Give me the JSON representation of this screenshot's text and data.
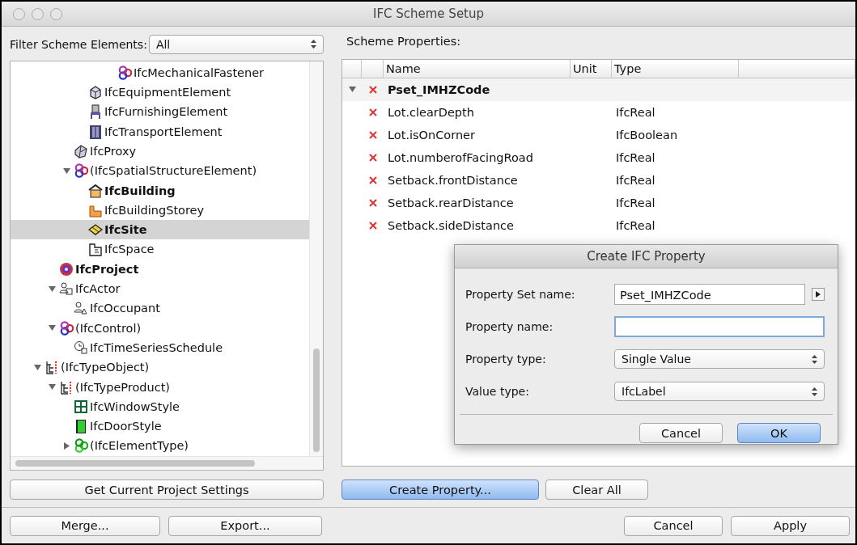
{
  "window": {
    "title": "IFC Scheme Setup"
  },
  "filter": {
    "label": "Filter Scheme Elements:",
    "value": "All"
  },
  "tree": [
    {
      "children": [
        {
          "children": [
            {
              "children": [
                {
                  "children": [
                    {
                      "children": [
                        {
                          "label": "IfcMechanicalFastener",
                          "kind": "tricolor",
                          "bold": false,
                          "selected": false
                        }
                      ]
                    }
                  ]
                },
                {
                  "label": "IfcEquipmentElement",
                  "kind": "equipment",
                  "bold": false,
                  "selected": false
                },
                {
                  "label": "IfcFurnishingElement",
                  "kind": "chair",
                  "bold": false,
                  "selected": false
                },
                {
                  "label": "IfcTransportElement",
                  "kind": "transport",
                  "bold": false,
                  "selected": false
                }
              ]
            },
            {
              "label": "IfcProxy",
              "kind": "proxy",
              "bold": false,
              "selected": false
            },
            {
              "label": "(IfcSpatialStructureElement)",
              "kind": "tricolor",
              "bold": false,
              "selected": false,
              "expanded": true,
              "children": [
                {
                  "label": "IfcBuilding",
                  "kind": "building",
                  "bold": true,
                  "selected": false
                },
                {
                  "label": "IfcBuildingStorey",
                  "kind": "storey",
                  "bold": false,
                  "selected": false
                },
                {
                  "label": "IfcSite",
                  "kind": "site",
                  "bold": true,
                  "selected": true
                },
                {
                  "label": "IfcSpace",
                  "kind": "space",
                  "bold": false,
                  "selected": false
                }
              ]
            }
          ]
        },
        {
          "label": "IfcProject",
          "kind": "project",
          "bold": true,
          "selected": false
        },
        {
          "label": "IfcActor",
          "kind": "actor",
          "bold": false,
          "selected": false,
          "expanded": true,
          "children": [
            {
              "label": "IfcOccupant",
              "kind": "occupant",
              "bold": false,
              "selected": false
            }
          ]
        },
        {
          "label": "(IfcControl)",
          "kind": "tricolor",
          "bold": false,
          "selected": false,
          "expanded": true,
          "children": [
            {
              "label": "IfcTimeSeriesSchedule",
              "kind": "schedule",
              "bold": false,
              "selected": false
            }
          ]
        }
      ]
    },
    {
      "label": "(IfcTypeObject)",
      "kind": "typetree",
      "bold": false,
      "selected": false,
      "expanded": true,
      "children": [
        {
          "label": "(IfcTypeProduct)",
          "kind": "typetree",
          "bold": false,
          "selected": false,
          "expanded": true,
          "children": [
            {
              "label": "IfcWindowStyle",
              "kind": "window",
              "bold": false,
              "selected": false
            },
            {
              "label": "IfcDoorStyle",
              "kind": "door",
              "bold": false,
              "selected": false
            },
            {
              "label": "(IfcElementType)",
              "kind": "clover",
              "bold": false,
              "selected": false,
              "expanded": false
            }
          ]
        }
      ]
    }
  ],
  "left_button": "Get Current Project Settings",
  "scheme": {
    "label": "Scheme Properties:",
    "columns": [
      "Name",
      "Unit",
      "Type"
    ],
    "groups": [
      {
        "name": "Pset_IMHZCode",
        "expanded": true,
        "rows": [
          {
            "name": "Lot.clearDepth",
            "type": "IfcReal"
          },
          {
            "name": "Lot.isOnCorner",
            "type": "IfcBoolean"
          },
          {
            "name": "Lot.numberofFacingRoad",
            "type": "IfcReal"
          },
          {
            "name": "Setback.frontDistance",
            "type": "IfcReal"
          },
          {
            "name": "Setback.rearDistance",
            "type": "IfcReal"
          },
          {
            "name": "Setback.sideDistance",
            "type": "IfcReal"
          }
        ]
      }
    ]
  },
  "scheme_buttons": [
    {
      "label": "Create Property...",
      "default": true
    },
    {
      "label": "Clear All",
      "default": false
    }
  ],
  "bottom_left": [
    "Merge...",
    "Export..."
  ],
  "bottom_right": [
    {
      "label": "Cancel",
      "default": false
    },
    {
      "label": "Apply",
      "default": false
    }
  ],
  "dialog": {
    "title": "Create IFC Property",
    "fields": [
      {
        "kind": "text",
        "label": "Property Set name:",
        "value": "Pset_IMHZCode",
        "focused": false,
        "menu": true
      },
      {
        "kind": "text",
        "label": "Property name:",
        "focused": true,
        "menu": false
      },
      {
        "kind": "select",
        "label": "Property type:",
        "value": "Single Value"
      },
      {
        "kind": "select",
        "label": "Value type:",
        "value": "IfcLabel"
      }
    ],
    "buttons": [
      {
        "label": "Cancel",
        "default": false
      },
      {
        "label": "OK",
        "default": true
      }
    ]
  }
}
